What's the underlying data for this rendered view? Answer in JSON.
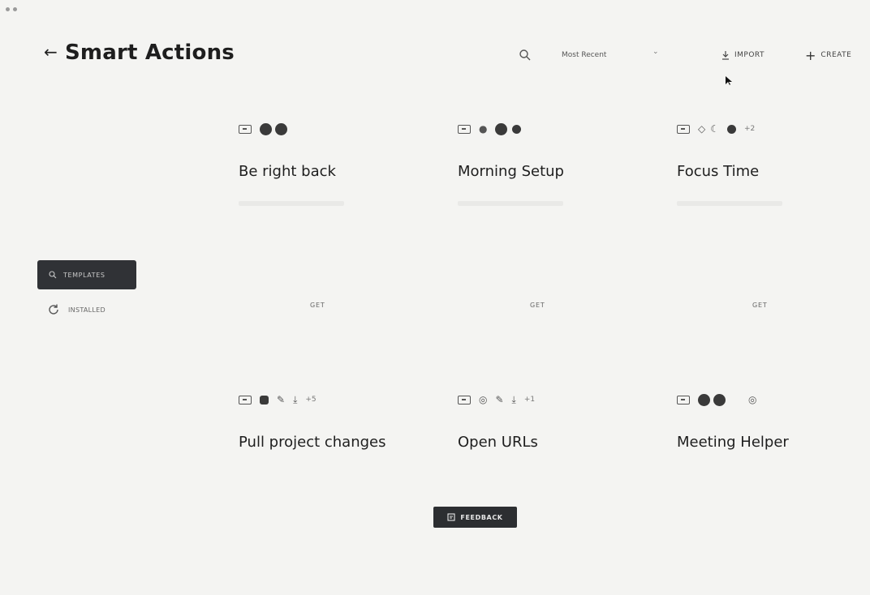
{
  "header": {
    "title": "Smart Actions",
    "sort_value": "Most Recent",
    "import_label": "IMPORT",
    "create_label": "CREATE"
  },
  "sidebar": {
    "templates_label": "TEMPLATES",
    "installed_label": "INSTALLED"
  },
  "cards": [
    {
      "title": "Be right back",
      "get_label": "GET",
      "extra_count": ""
    },
    {
      "title": "Morning Setup",
      "get_label": "GET",
      "extra_count": ""
    },
    {
      "title": "Focus Time",
      "get_label": "GET",
      "extra_count": "+2"
    },
    {
      "title": "Pull project changes",
      "get_label": "",
      "extra_count": "+5"
    },
    {
      "title": "Open URLs",
      "get_label": "",
      "extra_count": "+1"
    },
    {
      "title": "Meeting Helper",
      "get_label": "",
      "extra_count": ""
    }
  ],
  "feedback_label": "FEEDBACK",
  "icons": {
    "back": "back-arrow-icon",
    "search": "search-icon",
    "sort": "chevron-down-icon",
    "import": "download-icon",
    "create": "plus-icon",
    "templates": "search-icon",
    "installed": "refresh-icon",
    "feedback": "feedback-icon"
  },
  "colors": {
    "background": "#f4f4f2",
    "dark_button": "#303236",
    "text": "#1e1e1e"
  }
}
